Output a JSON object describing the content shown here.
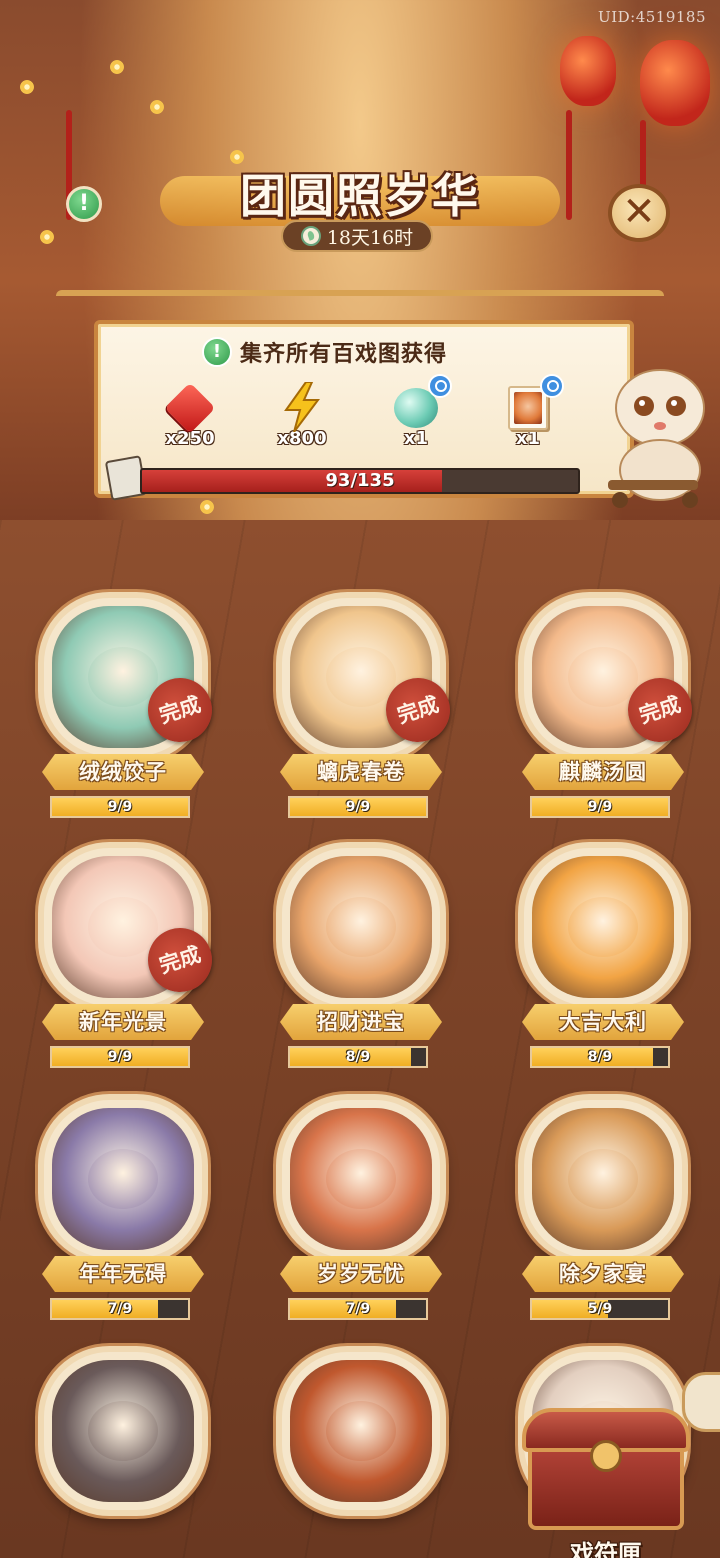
{
  "header": {
    "uid": "UID:4519185",
    "title": "团圆照岁华",
    "timer": "18天16时"
  },
  "buttons": {
    "info_glyph": "!",
    "close_glyph": "✕"
  },
  "reward_panel": {
    "heading": "集齐所有百戏图获得",
    "rewards": [
      {
        "icon": "red-gem-icon",
        "count": "x250"
      },
      {
        "icon": "lightning-bolt-icon",
        "count": "x800"
      },
      {
        "icon": "jade-orb-icon",
        "count": "x1",
        "inspectable": true
      },
      {
        "icon": "portrait-card-icon",
        "count": "x1",
        "inspectable": true
      }
    ],
    "progress": {
      "text": "93/135",
      "current": 93,
      "total": 135
    }
  },
  "collection": [
    {
      "name": "绒绒饺子",
      "progress": "9/9",
      "current": 9,
      "total": 9,
      "completed": true,
      "stamp": "完成",
      "theme": "#8fcab4"
    },
    {
      "name": "螭虎春卷",
      "progress": "9/9",
      "current": 9,
      "total": 9,
      "completed": true,
      "stamp": "完成",
      "theme": "#f0c58c"
    },
    {
      "name": "麒麟汤圆",
      "progress": "9/9",
      "current": 9,
      "total": 9,
      "completed": true,
      "stamp": "完成",
      "theme": "#f3b98a"
    },
    {
      "name": "新年光景",
      "progress": "9/9",
      "current": 9,
      "total": 9,
      "completed": true,
      "stamp": "完成",
      "theme": "#f3c7b6"
    },
    {
      "name": "招财进宝",
      "progress": "8/9",
      "current": 8,
      "total": 9,
      "completed": false,
      "theme": "#e8a46a"
    },
    {
      "name": "大吉大利",
      "progress": "8/9",
      "current": 8,
      "total": 9,
      "completed": false,
      "theme": "#f2a444"
    },
    {
      "name": "年年无碍",
      "progress": "7/9",
      "current": 7,
      "total": 9,
      "completed": false,
      "theme": "#8a7aa8"
    },
    {
      "name": "岁岁无忧",
      "progress": "7/9",
      "current": 7,
      "total": 9,
      "completed": false,
      "theme": "#d8744a"
    },
    {
      "name": "除夕家宴",
      "progress": "5/9",
      "current": 5,
      "total": 9,
      "completed": false,
      "theme": "#d99a58"
    },
    {
      "name": "",
      "theme": "#6a5a5a"
    },
    {
      "name": "",
      "theme": "#c0582e"
    },
    {
      "name": "",
      "theme": "#e3cfc0"
    }
  ],
  "chest": {
    "label": "戏符匣"
  },
  "colors": {
    "accent_gold": "#e2a43c",
    "progress_red": "#c0302a",
    "panel_border": "#c9853f"
  }
}
